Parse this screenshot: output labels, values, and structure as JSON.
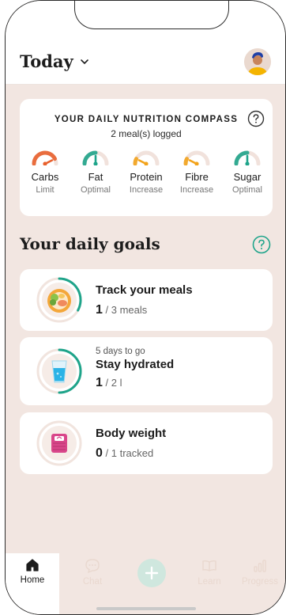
{
  "header": {
    "title": "Today"
  },
  "compass": {
    "title": "YOUR DAILY NUTRITION COMPASS",
    "subtitle": "2 meal(s) logged",
    "gauges": [
      {
        "name": "Carbs",
        "status": "Limit",
        "color": "#e8602c",
        "level": 0.85
      },
      {
        "name": "Fat",
        "status": "Optimal",
        "color": "#1ea48a",
        "level": 0.5
      },
      {
        "name": "Protein",
        "status": "Increase",
        "color": "#f2a31b",
        "level": 0.15
      },
      {
        "name": "Fibre",
        "status": "Increase",
        "color": "#f2a31b",
        "level": 0.15
      },
      {
        "name": "Sugar",
        "status": "Optimal",
        "color": "#1ea48a",
        "level": 0.5
      }
    ]
  },
  "goals": {
    "title": "Your daily goals",
    "cards": [
      {
        "pre": "",
        "title": "Track your meals",
        "current": "1",
        "total": "/ 3 meals",
        "progress": 0.33
      },
      {
        "pre": "5 days to go",
        "title": "Stay hydrated",
        "current": "1",
        "total": "/ 2 l",
        "progress": 0.5
      },
      {
        "pre": "",
        "title": "Body weight",
        "current": "0",
        "total": "/ 1 tracked",
        "progress": 0
      }
    ]
  },
  "tabbar": {
    "home": "Home",
    "chat": "Chat",
    "learn": "Learn",
    "progress": "Progress"
  },
  "colors": {
    "accent": "#1ea48a",
    "background": "#f2e6e1",
    "warning": "#f2a31b",
    "danger": "#e8602c"
  }
}
